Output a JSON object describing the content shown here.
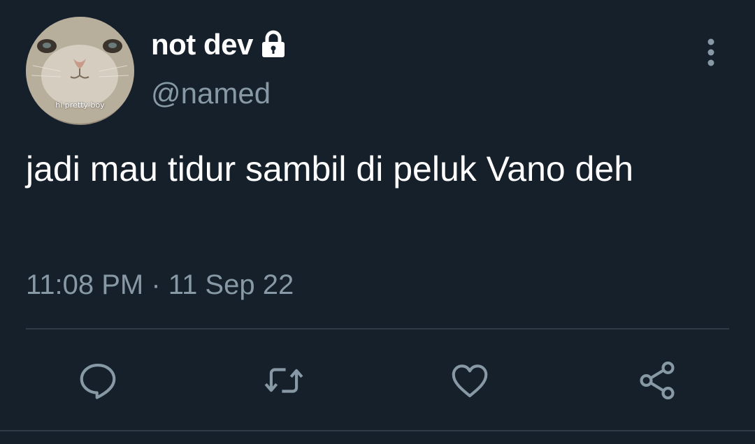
{
  "tweet": {
    "display_name": "not dev",
    "handle": "@named",
    "text": "jadi mau tidur sambil di peluk Vano deh",
    "timestamp": "11:08 PM · 11 Sep 22",
    "avatar_caption": "hi pretty boy",
    "protected_icon": "lock-icon",
    "more_icon": "more-vertical-icon"
  },
  "actions": [
    {
      "name": "reply",
      "icon": "reply-icon"
    },
    {
      "name": "retweet",
      "icon": "retweet-icon"
    },
    {
      "name": "like",
      "icon": "heart-icon"
    },
    {
      "name": "share",
      "icon": "share-icon"
    }
  ],
  "colors": {
    "background": "#16202b",
    "text": "#ffffff",
    "secondary_text": "#8899a6",
    "divider": "#2f3b47"
  }
}
